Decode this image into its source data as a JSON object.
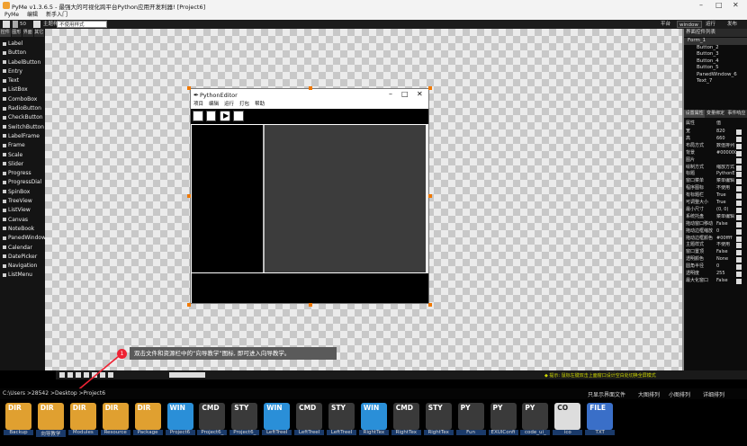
{
  "window": {
    "title": "PyMe v1.3.6.5 - 最强大的可视化跨平台Python应用开发利器! [Project6]",
    "controls": [
      "–",
      "□",
      "✕"
    ]
  },
  "menubar": {
    "items": [
      "PyMe",
      "编辑",
      "新手入门"
    ]
  },
  "toolbar": {
    "zoom": "50",
    "theme_label": "主题样式",
    "style_value": "不使用样式",
    "platform_label": "平台",
    "platform_value": "window",
    "run_label": "运行",
    "publish_label": "发布"
  },
  "left_panel": {
    "tabs": [
      "控件",
      "图形",
      "界面",
      "其它"
    ],
    "components": [
      "Label",
      "Button",
      "LabelButton",
      "Entry",
      "Text",
      "ListBox",
      "ComboBox",
      "RadioButton",
      "CheckButton",
      "SwitchButton",
      "LabelFrame",
      "Frame",
      "Scale",
      "Slider",
      "Progress",
      "ProgressDial",
      "SpinBox",
      "TreeView",
      "ListView",
      "Canvas",
      "NoteBook",
      "PanedWindow",
      "Calendar",
      "DatePicker",
      "Navigation",
      "ListMenu"
    ]
  },
  "designer": {
    "form_title": "PythonEditor",
    "form_menu": [
      "项目",
      "编辑",
      "运行",
      "打包",
      "帮助"
    ]
  },
  "right_panel": {
    "tree_header": "界面控件列表",
    "tree": [
      "Form_1",
      "Button_2",
      "Button_3",
      "Button_4",
      "Button_5",
      "PanedWindow_6",
      "Text_7"
    ],
    "prop_tabs": [
      "设置属性",
      "变量绑定",
      "事件响应"
    ],
    "prop_header": {
      "k": "属性",
      "v": "值"
    },
    "props": [
      [
        "宽",
        "820"
      ],
      [
        "高",
        "660"
      ],
      [
        "布局方式",
        "数值排列"
      ],
      [
        "背景",
        "#000000"
      ],
      [
        "图片",
        ""
      ],
      [
        "绘制方式",
        "缩放方式"
      ],
      [
        "标题",
        "PythonE"
      ],
      [
        "窗口菜单",
        "菜单编辑"
      ],
      [
        "程序图标",
        "不使用"
      ],
      [
        "有标题栏",
        "True"
      ],
      [
        "可调整大小",
        "True"
      ],
      [
        "最小尺寸",
        "(0, 0)"
      ],
      [
        "系统托盘",
        "菜单编辑"
      ],
      [
        "拖动窗口移动",
        "False"
      ],
      [
        "拖动边框缩放",
        "0"
      ],
      [
        "拖动边框颜色",
        "#00ffff"
      ],
      [
        "主题样式",
        "不使用"
      ],
      [
        "窗口置顶",
        "False"
      ],
      [
        "透明颜色",
        "None"
      ],
      [
        "圆角半径",
        "0"
      ],
      [
        "透明度",
        "255"
      ],
      [
        "最大化窗口",
        "False"
      ]
    ]
  },
  "tip": {
    "number": "1",
    "text": "双击文件和资源栏中的“向导教学”图标, 即可进入向导教学。"
  },
  "status": {
    "text": "◆ 提示: 鼠标左键双击上面窗口设计空白处切换全屏模式"
  },
  "pathbar": {
    "path": "C:\\Users >28542 >Desktop >Project6",
    "options": [
      "只显示界面文件",
      "大图排列",
      "小图排列",
      "详细排列"
    ]
  },
  "files": [
    {
      "type": "DIR",
      "label": "Backup",
      "color": "#e0a030"
    },
    {
      "type": "DIR",
      "label": "向导教学",
      "color": "#e0a030"
    },
    {
      "type": "DIR",
      "label": "Modules",
      "color": "#e0a030"
    },
    {
      "type": "DIR",
      "label": "Resource",
      "color": "#e0a030"
    },
    {
      "type": "DIR",
      "label": "Package",
      "color": "#e0a030"
    },
    {
      "type": "WIN",
      "label": "Project6",
      "color": "#2a8fd8"
    },
    {
      "type": "CMD",
      "label": "Project6_",
      "color": "#3a3a3a"
    },
    {
      "type": "STY",
      "label": "Project6_",
      "color": "#3a3a3a"
    },
    {
      "type": "WIN",
      "label": "LeftTreeI",
      "color": "#2a8fd8"
    },
    {
      "type": "CMD",
      "label": "LeftTreeI",
      "color": "#3a3a3a"
    },
    {
      "type": "STY",
      "label": "LeftTreeI",
      "color": "#3a3a3a"
    },
    {
      "type": "WIN",
      "label": "RightTex",
      "color": "#2a8fd8"
    },
    {
      "type": "CMD",
      "label": "RightTex",
      "color": "#3a3a3a"
    },
    {
      "type": "STY",
      "label": "RightTex",
      "color": "#3a3a3a"
    },
    {
      "type": "PY",
      "label": "Fun",
      "color": "#3a3a3a"
    },
    {
      "type": "PY",
      "label": "EXUIConfi",
      "color": "#3a3a3a"
    },
    {
      "type": "PY",
      "label": "code_ui_",
      "color": "#3a3a3a"
    },
    {
      "type": "CO",
      "label": "ico",
      "color": "#dddddd"
    },
    {
      "type": "FILE",
      "label": "TXT",
      "color": "#3a6fc8"
    }
  ]
}
